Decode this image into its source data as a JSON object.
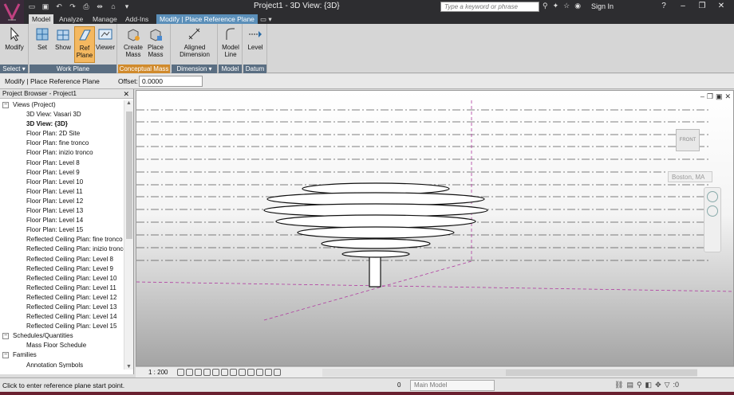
{
  "title": "Project1 - 3D View: {3D}",
  "search_placeholder": "Type a keyword or phrase",
  "sign_in": "Sign In",
  "tabs": [
    "Model",
    "Analyze",
    "Manage",
    "Add-Ins",
    "Modify | Place Reference Plane"
  ],
  "ribbon": {
    "buttons": [
      "Modify",
      "Set",
      "Show",
      "Ref Plane",
      "Viewer",
      "Create Mass",
      "Place Mass",
      "Aligned Dimension",
      "Model Line",
      "Level"
    ],
    "panels": [
      "Select ▾",
      "Work Plane",
      "Conceptual Mass",
      "Dimension ▾",
      "Model",
      "Datum"
    ]
  },
  "options_bar": {
    "context": "Modify | Place Reference Plane",
    "offset_label": "Offset:",
    "offset_value": "0.0000"
  },
  "browser": {
    "title": "Project Browser - Project1",
    "views_root": "Views (Project)",
    "views": [
      "3D View: Vasari 3D",
      "3D View: {3D}",
      "Floor Plan: 2D Site",
      "Floor Plan: fine tronco",
      "Floor Plan: inizio tronco",
      "Floor Plan: Level 8",
      "Floor Plan: Level 9",
      "Floor Plan: Level 10",
      "Floor Plan: Level 11",
      "Floor Plan: Level 12",
      "Floor Plan: Level 13",
      "Floor Plan: Level 14",
      "Floor Plan: Level 15",
      "Reflected Ceiling Plan: fine tronco",
      "Reflected Ceiling Plan: inizio tronco",
      "Reflected Ceiling Plan: Level 8",
      "Reflected Ceiling Plan: Level 9",
      "Reflected Ceiling Plan: Level 10",
      "Reflected Ceiling Plan: Level 11",
      "Reflected Ceiling Plan: Level 12",
      "Reflected Ceiling Plan: Level 13",
      "Reflected Ceiling Plan: Level 14",
      "Reflected Ceiling Plan: Level 15"
    ],
    "schedules": "Schedules/Quantities",
    "schedule_item": "Mass Floor Schedule",
    "families": "Families",
    "annotation": "Annotation Symbols"
  },
  "viewport": {
    "viewcube_label": "FRONT",
    "location": "Boston, MA"
  },
  "view_control": {
    "scale": "1 : 200"
  },
  "status": {
    "message": "Click to enter reference plane start point.",
    "workset_value": "0",
    "model": "Main Model",
    "filter_count": ":0"
  }
}
